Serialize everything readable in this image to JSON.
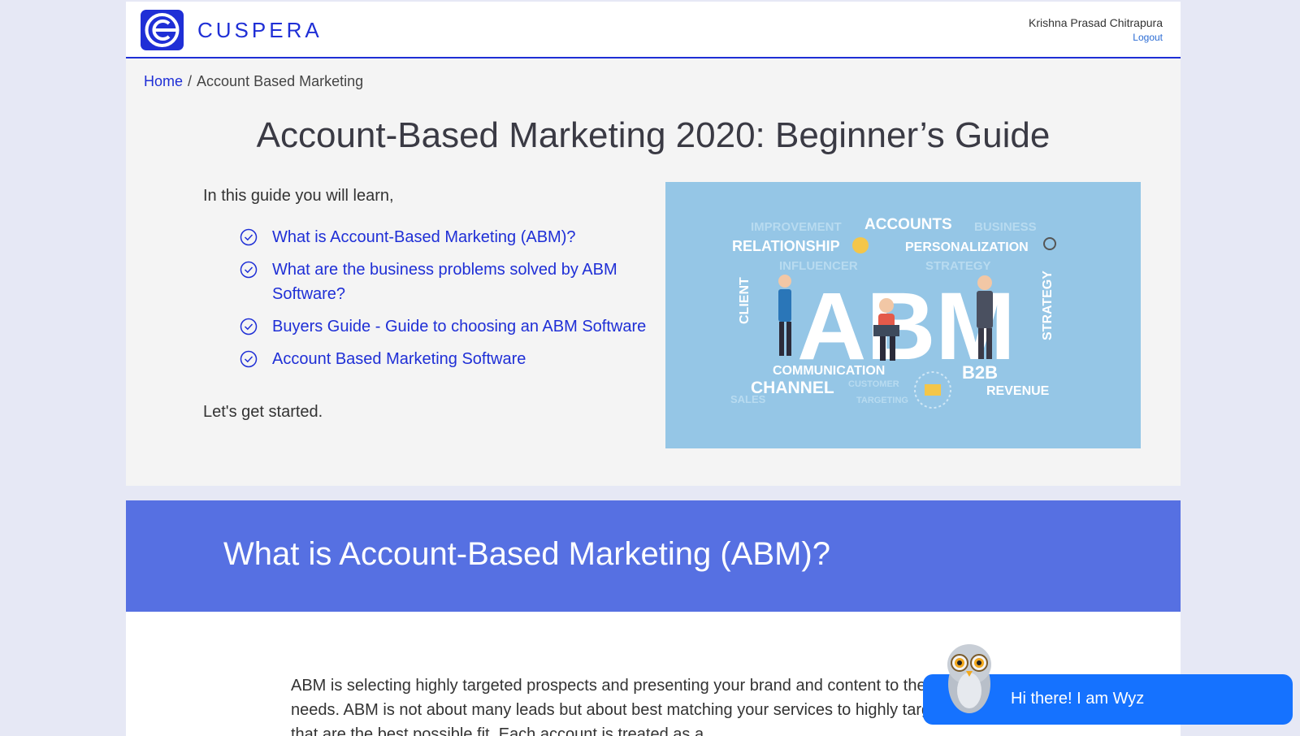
{
  "header": {
    "brand": "CUSPERA",
    "user_name": "Krishna Prasad Chitrapura",
    "logout_label": "Logout"
  },
  "breadcrumb": {
    "home": "Home",
    "separator": "/",
    "current": "Account Based Marketing"
  },
  "intro": {
    "title": "Account-Based Marketing 2020: Beginner’s Guide",
    "lead": "In this guide you will learn,",
    "toc": [
      {
        "label": "What is Account-Based Marketing (ABM)?"
      },
      {
        "label": "What are the business problems solved by ABM Software?"
      },
      {
        "label": "Buyers Guide - Guide to choosing an ABM Software"
      },
      {
        "label": "Account Based Marketing Software"
      }
    ],
    "outro": "Let's get started."
  },
  "hero_image": {
    "words": [
      "IMPROVEMENT",
      "ACCOUNTS",
      "BUSINESS",
      "RELATIONSHIP",
      "PERSONALIZATION",
      "INFLUENCER",
      "STRATEGY",
      "CLIENT",
      "ABM",
      "COMMUNICATION",
      "CHANNEL",
      "B2B",
      "REVENUE",
      "SALES",
      "CUSTOMER",
      "TARGETING"
    ]
  },
  "section": {
    "heading": "What is Account-Based Marketing (ABM)?",
    "body": "ABM is selecting highly targeted prospects and presenting your brand and content to their business needs. ABM is not about many leads but about best matching your services to highly targeted accounts that are the best possible fit. Each account is treated as a"
  },
  "chat": {
    "greeting": "Hi there! I am Wyz"
  },
  "colors": {
    "brand_blue": "#1f2fd6",
    "band_blue": "#5670e2",
    "chat_blue": "#1572ff",
    "hero_bg": "#95c6e6"
  }
}
